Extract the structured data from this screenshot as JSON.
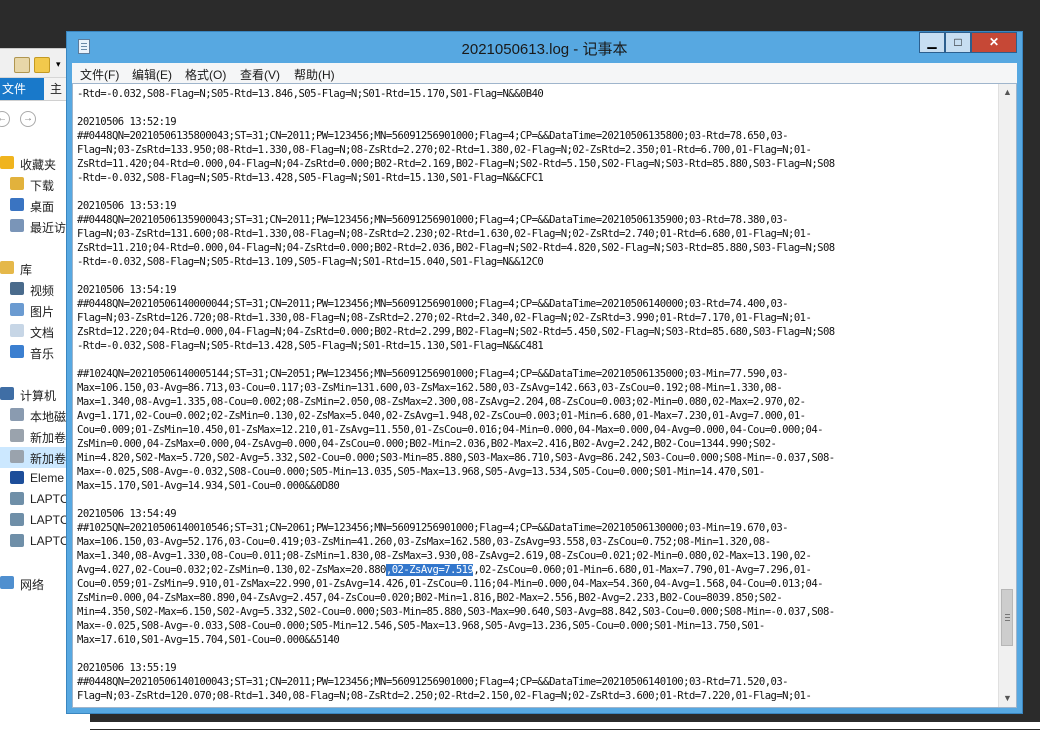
{
  "window": {
    "title": "2021050613.log - 记事本",
    "controls": {
      "minimize": "▁",
      "maximize": "□",
      "close": "✕"
    }
  },
  "menu": [
    "文件(F)",
    "编辑(E)",
    "格式(O)",
    "查看(V)",
    "帮助(H)"
  ],
  "explorer": {
    "ribbon": {
      "file_tab": "文件",
      "home_tab": "主"
    },
    "tree": [
      {
        "label": "收藏夹",
        "icon": "star-icon"
      },
      {
        "label": "下载",
        "icon": "download-folder-icon"
      },
      {
        "label": "桌面",
        "icon": "desktop-icon"
      },
      {
        "label": "最近访",
        "icon": "recent-places-icon"
      },
      {
        "label": "",
        "icon": ""
      },
      {
        "label": "库",
        "icon": "library-icon"
      },
      {
        "label": "视频",
        "icon": "video-icon"
      },
      {
        "label": "图片",
        "icon": "pictures-icon"
      },
      {
        "label": "文档",
        "icon": "documents-icon"
      },
      {
        "label": "音乐",
        "icon": "music-icon"
      },
      {
        "label": "",
        "icon": ""
      },
      {
        "label": "计算机",
        "icon": "computer-icon"
      },
      {
        "label": "本地磁",
        "icon": "local-disk-icon"
      },
      {
        "label": "新加卷",
        "icon": "drive-icon"
      },
      {
        "label": "新加卷",
        "icon": "drive-icon"
      },
      {
        "label": "Eleme",
        "icon": "wd-drive-icon"
      },
      {
        "label": "LAPTC",
        "icon": "network-drive-icon"
      },
      {
        "label": "LAPTC",
        "icon": "network-drive-icon"
      },
      {
        "label": "LAPTC",
        "icon": "network-drive-icon"
      },
      {
        "label": "",
        "icon": ""
      },
      {
        "label": "网络",
        "icon": "network-icon"
      }
    ]
  },
  "log_lines": [
    "-Rtd=-0.032,S08-Flag=N;S05-Rtd=13.846,S05-Flag=N;S01-Rtd=15.170,S01-Flag=N&&0B40",
    "",
    "20210506 13:52:19",
    "##0448QN=20210506135800043;ST=31;CN=2011;PW=123456;MN=56091256901000;Flag=4;CP=&&DataTime=20210506135800;03-Rtd=78.650,03-",
    "Flag=N;03-ZsRtd=133.950;08-Rtd=1.330,08-Flag=N;08-ZsRtd=2.270;02-Rtd=1.380,02-Flag=N;02-ZsRtd=2.350;01-Rtd=6.700,01-Flag=N;01-",
    "ZsRtd=11.420;04-Rtd=0.000,04-Flag=N;04-ZsRtd=0.000;B02-Rtd=2.169,B02-Flag=N;S02-Rtd=5.150,S02-Flag=N;S03-Rtd=85.880,S03-Flag=N;S08",
    "-Rtd=-0.032,S08-Flag=N;S05-Rtd=13.428,S05-Flag=N;S01-Rtd=15.130,S01-Flag=N&&CFC1",
    "",
    "20210506 13:53:19",
    "##0448QN=20210506135900043;ST=31;CN=2011;PW=123456;MN=56091256901000;Flag=4;CP=&&DataTime=20210506135900;03-Rtd=78.380,03-",
    "Flag=N;03-ZsRtd=131.600;08-Rtd=1.330,08-Flag=N;08-ZsRtd=2.230;02-Rtd=1.630,02-Flag=N;02-ZsRtd=2.740;01-Rtd=6.680,01-Flag=N;01-",
    "ZsRtd=11.210;04-Rtd=0.000,04-Flag=N;04-ZsRtd=0.000;B02-Rtd=2.036,B02-Flag=N;S02-Rtd=4.820,S02-Flag=N;S03-Rtd=85.880,S03-Flag=N;S08",
    "-Rtd=-0.032,S08-Flag=N;S05-Rtd=13.109,S05-Flag=N;S01-Rtd=15.040,S01-Flag=N&&12C0",
    "",
    "20210506 13:54:19",
    "##0448QN=20210506140000044;ST=31;CN=2011;PW=123456;MN=56091256901000;Flag=4;CP=&&DataTime=20210506140000;03-Rtd=74.400,03-",
    "Flag=N;03-ZsRtd=126.720;08-Rtd=1.330,08-Flag=N;08-ZsRtd=2.270;02-Rtd=2.340,02-Flag=N;02-ZsRtd=3.990;01-Rtd=7.170,01-Flag=N;01-",
    "ZsRtd=12.220;04-Rtd=0.000,04-Flag=N;04-ZsRtd=0.000;B02-Rtd=2.299,B02-Flag=N;S02-Rtd=5.450,S02-Flag=N;S03-Rtd=85.680,S03-Flag=N;S08",
    "-Rtd=-0.032,S08-Flag=N;S05-Rtd=13.428,S05-Flag=N;S01-Rtd=15.130,S01-Flag=N&&C481",
    "",
    "##1024QN=20210506140005144;ST=31;CN=2051;PW=123456;MN=56091256901000;Flag=4;CP=&&DataTime=20210506135000;03-Min=77.590,03-",
    "Max=106.150,03-Avg=86.713,03-Cou=0.117;03-ZsMin=131.600,03-ZsMax=162.580,03-ZsAvg=142.663,03-ZsCou=0.192;08-Min=1.330,08-",
    "Max=1.340,08-Avg=1.335,08-Cou=0.002;08-ZsMin=2.050,08-ZsMax=2.300,08-ZsAvg=2.204,08-ZsCou=0.003;02-Min=0.080,02-Max=2.970,02-",
    "Avg=1.171,02-Cou=0.002;02-ZsMin=0.130,02-ZsMax=5.040,02-ZsAvg=1.948,02-ZsCou=0.003;01-Min=6.680,01-Max=7.230,01-Avg=7.000,01-",
    "Cou=0.009;01-ZsMin=10.450,01-ZsMax=12.210,01-ZsAvg=11.550,01-ZsCou=0.016;04-Min=0.000,04-Max=0.000,04-Avg=0.000,04-Cou=0.000;04-",
    "ZsMin=0.000,04-ZsMax=0.000,04-ZsAvg=0.000,04-ZsCou=0.000;B02-Min=2.036,B02-Max=2.416,B02-Avg=2.242,B02-Cou=1344.990;S02-",
    "Min=4.820,S02-Max=5.720,S02-Avg=5.332,S02-Cou=0.000;S03-Min=85.880,S03-Max=86.710,S03-Avg=86.242,S03-Cou=0.000;S08-Min=-0.037,S08-",
    "Max=-0.025,S08-Avg=-0.032,S08-Cou=0.000;S05-Min=13.035,S05-Max=13.968,S05-Avg=13.534,S05-Cou=0.000;S01-Min=14.470,S01-",
    "Max=15.170,S01-Avg=14.934,S01-Cou=0.000&&0D80",
    "",
    "20210506 13:54:49",
    "##1025QN=20210506140010546;ST=31;CN=2061;PW=123456;MN=56091256901000;Flag=4;CP=&&DataTime=20210506130000;03-Min=19.670,03-",
    "Max=106.150,03-Avg=52.176,03-Cou=0.419;03-ZsMin=41.260,03-ZsMax=162.580,03-ZsAvg=93.558,03-ZsCou=0.752;08-Min=1.320,08-",
    "Max=1.340,08-Avg=1.330,08-Cou=0.011;08-ZsMin=1.830,08-ZsMax=3.930,08-ZsAvg=2.619,08-ZsCou=0.021;02-Min=0.080,02-Max=13.190,02-",
    "Avg=4.027,02-Cou=0.032;02-ZsMin=0.130,02-ZsMax=20.880,02-ZsAvg=7.519,02-ZsCou=0.060;01-Min=6.680,01-Max=7.790,01-Avg=7.296,01-",
    "Cou=0.059;01-ZsMin=9.910,01-ZsMax=22.990,01-ZsAvg=14.426,01-ZsCou=0.116;04-Min=0.000,04-Max=54.360,04-Avg=1.568,04-Cou=0.013;04-",
    "ZsMin=0.000,04-ZsMax=80.890,04-ZsAvg=2.457,04-ZsCou=0.020;B02-Min=1.816,B02-Max=2.556,B02-Avg=2.233,B02-Cou=8039.850;S02-",
    "Min=4.350,S02-Max=6.150,S02-Avg=5.332,S02-Cou=0.000;S03-Min=85.880,S03-Max=90.640,S03-Avg=88.842,S03-Cou=0.000;S08-Min=-0.037,S08-",
    "Max=-0.025,S08-Avg=-0.033,S08-Cou=0.000;S05-Min=12.546,S05-Max=13.968,S05-Avg=13.236,S05-Cou=0.000;S01-Min=13.750,S01-",
    "Max=17.610,S01-Avg=15.704,S01-Cou=0.000&&5140",
    "",
    "20210506 13:55:19",
    "##0448QN=20210506140100043;ST=31;CN=2011;PW=123456;MN=56091256901000;Flag=4;CP=&&DataTime=20210506140100;03-Rtd=71.520,03-",
    "Flag=N;03-ZsRtd=120.070;08-Rtd=1.340,08-Flag=N;08-ZsRtd=2.250;02-Rtd=2.150,02-Flag=N;02-ZsRtd=3.600;01-Rtd=7.220,01-Flag=N;01-"
  ],
  "selection": {
    "line": 34,
    "text": ",02-ZsAvg=7.519"
  },
  "scrollbar": {
    "up": "▲",
    "down": "▼",
    "position": 0.81
  }
}
